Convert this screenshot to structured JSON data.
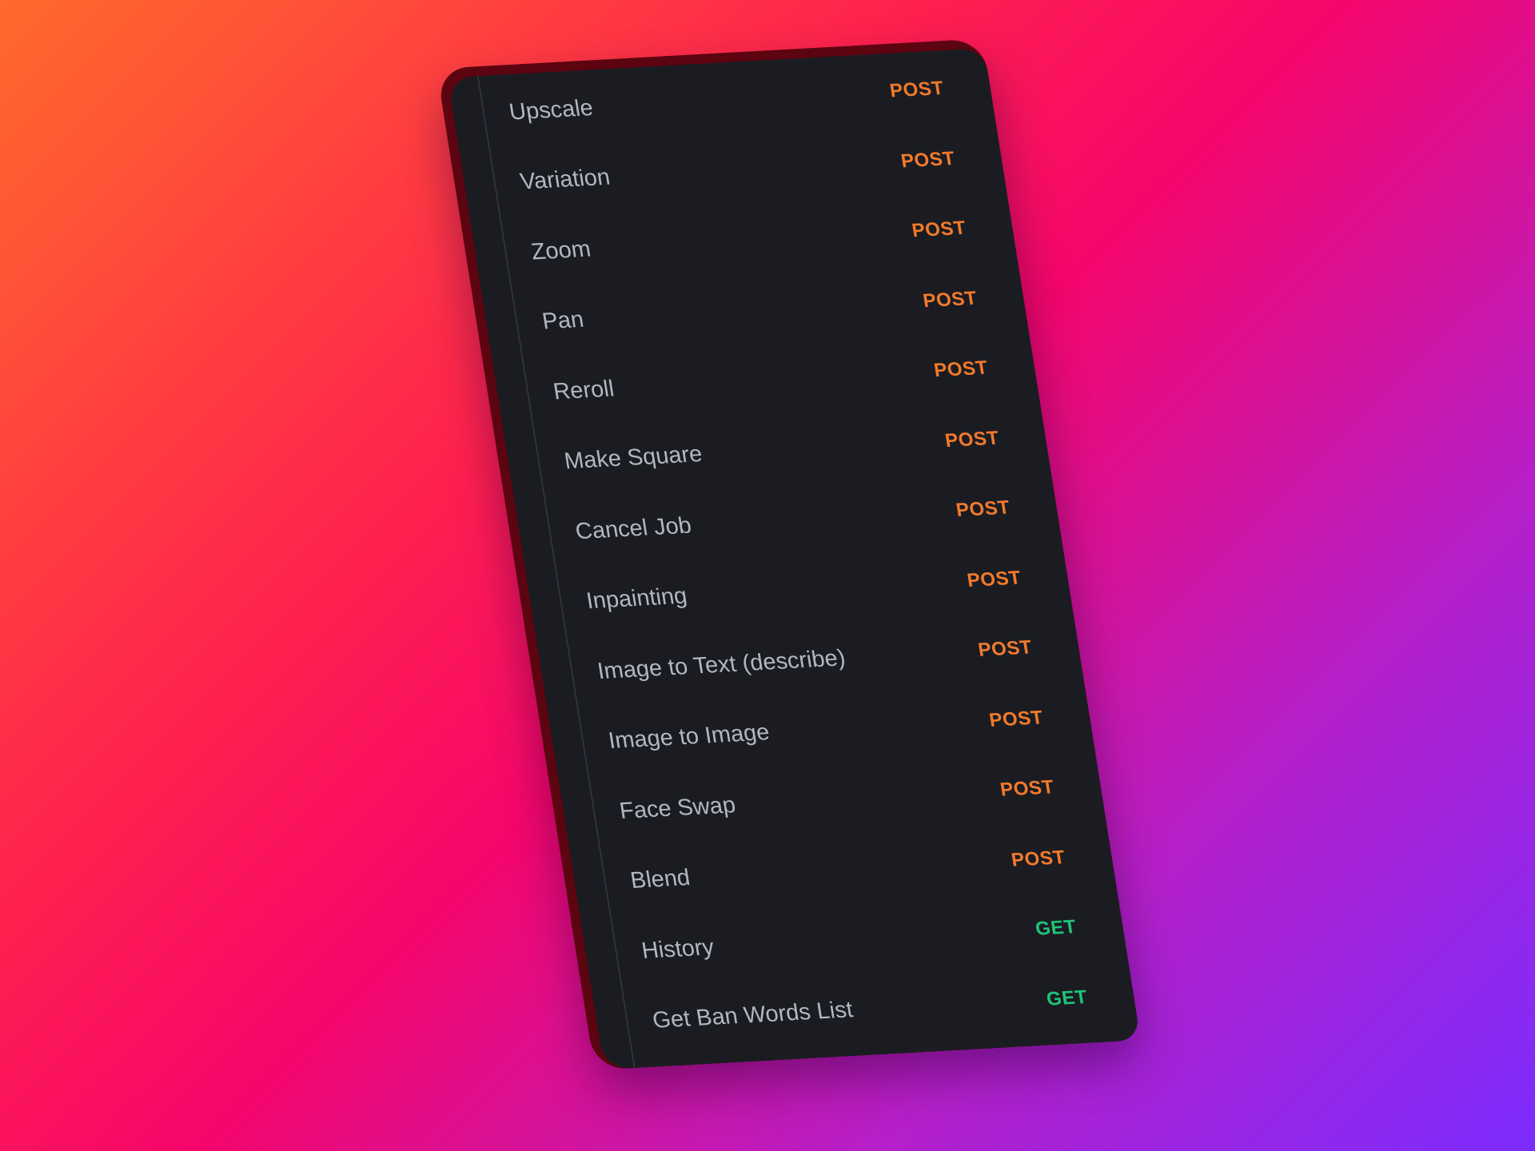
{
  "colors": {
    "post": "#f27a2a",
    "get": "#1fc477"
  },
  "endpoints": [
    {
      "label": "Upscale",
      "method": "POST"
    },
    {
      "label": "Variation",
      "method": "POST"
    },
    {
      "label": "Zoom",
      "method": "POST"
    },
    {
      "label": "Pan",
      "method": "POST"
    },
    {
      "label": "Reroll",
      "method": "POST"
    },
    {
      "label": "Make Square",
      "method": "POST"
    },
    {
      "label": "Cancel Job",
      "method": "POST"
    },
    {
      "label": "Inpainting",
      "method": "POST"
    },
    {
      "label": "Image to Text (describe)",
      "method": "POST"
    },
    {
      "label": "Image to Image",
      "method": "POST"
    },
    {
      "label": "Face Swap",
      "method": "POST"
    },
    {
      "label": "Blend",
      "method": "POST"
    },
    {
      "label": "History",
      "method": "GET"
    },
    {
      "label": "Get Ban Words List",
      "method": "GET"
    }
  ]
}
